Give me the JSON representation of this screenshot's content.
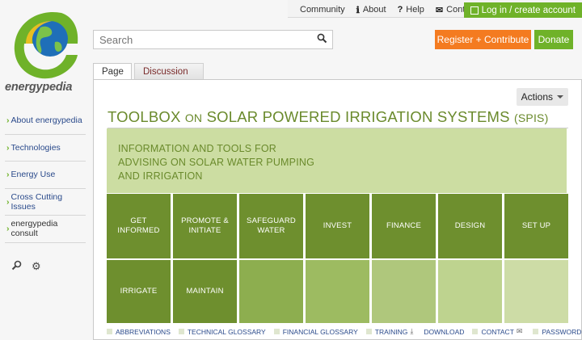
{
  "topnav": {
    "community": "Community",
    "about": "About",
    "help": "Help",
    "contact": "Contact",
    "login": "Log in / create account"
  },
  "logo": {
    "text": "energypedia"
  },
  "search": {
    "placeholder": "Search"
  },
  "buttons": {
    "register": "Register + Contribute",
    "donate": "Donate"
  },
  "tabs": {
    "page": "Page",
    "discussion": "Discussion"
  },
  "actions": "Actions",
  "sidebar": {
    "items": [
      {
        "label": "About energypedia"
      },
      {
        "label": "Technologies"
      },
      {
        "label": "Energy Use"
      },
      {
        "label": "Cross Cutting Issues"
      },
      {
        "label": "energypedia consult"
      }
    ]
  },
  "title": {
    "part1": "TOOLBOX ",
    "part2": "ON",
    "part3": " SOLAR POWERED IRRIGATION SYSTEMS ",
    "part4": "(SPIS)"
  },
  "hero": {
    "line1": "INFORMATION AND TOOLS FOR",
    "line2": "ADVISING ON SOLAR WATER PUMPING",
    "line3": "AND IRRIGATION"
  },
  "tiles": {
    "get_informed": "GET INFORMED",
    "promote": "PROMOTE & INITIATE",
    "safeguard": "SAFEGUARD WATER",
    "invest": "INVEST",
    "finance": "FINANCE",
    "design": "DESIGN",
    "setup": "SET UP",
    "irrigate": "IRRIGATE",
    "maintain": "MAINTAIN"
  },
  "footer": {
    "abbreviations": "ABBREVIATIONS",
    "technical_glossary": "TECHNICAL GLOSSARY",
    "financial_glossary": "FINANCIAL GLOSSARY",
    "training": "TRAINING",
    "download": "DOWNLOAD",
    "contact": "CONTACT",
    "password": "PASSWORD"
  },
  "colors": {
    "accent_green": "#6fb229",
    "orange": "#f47b20",
    "tile_dark": "#6e8f2e",
    "hero": "#ccdda2"
  }
}
